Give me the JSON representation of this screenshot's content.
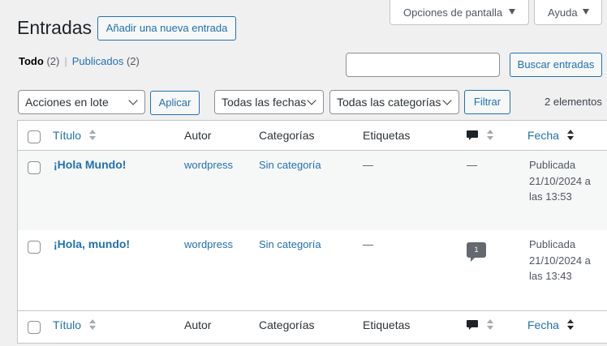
{
  "screen_meta": {
    "screen_options_label": "Opciones de pantalla",
    "help_label": "Ayuda"
  },
  "header": {
    "title": "Entradas",
    "add_new_label": "Añadir una nueva entrada"
  },
  "views": {
    "all_label": "Todo",
    "all_count": "(2)",
    "separator": "|",
    "published_label": "Publicados",
    "published_count": "(2)"
  },
  "search": {
    "value": "",
    "button_label": "Buscar entradas"
  },
  "tablenav": {
    "bulk_action_selected": "Acciones en lote",
    "apply_label": "Aplicar",
    "date_filter_selected": "Todas las fechas",
    "category_filter_selected": "Todas las categorías",
    "filter_label": "Filtrar",
    "items_count": "2 elementos"
  },
  "columns": {
    "title": "Título",
    "author": "Autor",
    "categories": "Categorías",
    "tags": "Etiquetas",
    "comments_icon": "comment-icon",
    "date": "Fecha"
  },
  "rows": [
    {
      "title": "¡Hola Mundo!",
      "author": "wordpress",
      "category": "Sin categoría",
      "tags": "—",
      "comments": "—",
      "date_status": "Publicada",
      "date_day": "21/10/2024 a",
      "date_time": "las 13:53"
    },
    {
      "title": "¡Hola, mundo!",
      "author": "wordpress",
      "category": "Sin categoría",
      "tags": "—",
      "comments": "1",
      "date_status": "Publicada",
      "date_day": "21/10/2024 a",
      "date_time": "las 13:43"
    }
  ],
  "colors": {
    "accent": "#2271b1",
    "background": "#f0f0f1",
    "text": "#3c434a",
    "bubble": "#646970"
  }
}
